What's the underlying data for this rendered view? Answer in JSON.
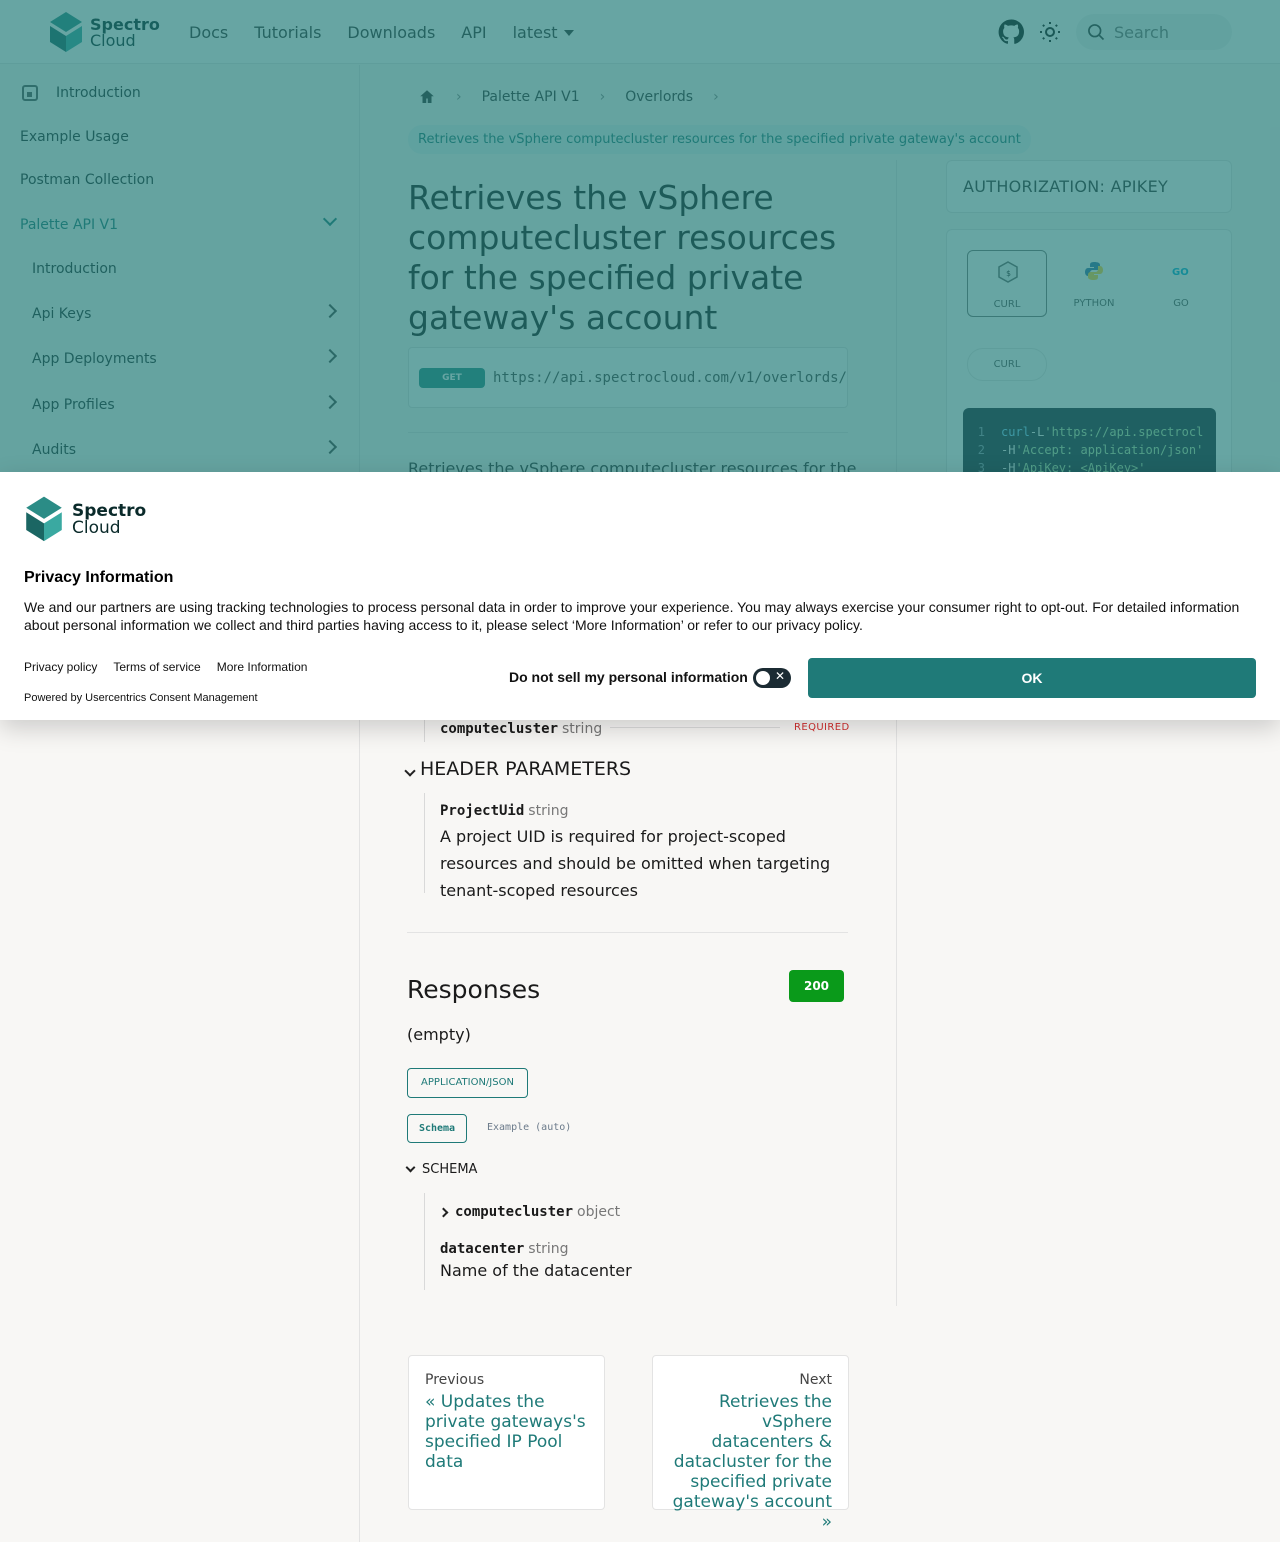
{
  "brand": {
    "line1": "Spectro",
    "line2": "Cloud"
  },
  "nav": {
    "links": [
      "Docs",
      "Tutorials",
      "Downloads",
      "API"
    ],
    "version": "latest",
    "search_placeholder": "Search"
  },
  "sidebar": {
    "items": [
      {
        "label": "Introduction",
        "level": 0
      },
      {
        "label": "Example Usage",
        "level": 0
      },
      {
        "label": "Postman Collection",
        "level": 0
      },
      {
        "label": "Palette API V1",
        "level": 0,
        "expanded": true
      },
      {
        "label": "Introduction",
        "level": 1
      },
      {
        "label": "Api Keys",
        "level": 1
      },
      {
        "label": "App Deployments",
        "level": 1
      },
      {
        "label": "App Profiles",
        "level": 1
      },
      {
        "label": "Audits",
        "level": 1
      }
    ]
  },
  "breadcrumb": {
    "items": [
      "Palette API V1",
      "Overlords"
    ],
    "current": "Retrieves the vSphere computecluster resources for the specified private gateway's account"
  },
  "page": {
    "title": "Retrieves the vSphere computecluster resources for the specified private gateway's account",
    "method": "GET",
    "url": "https://api.spectrocloud.com/v1/overlords/",
    "desc_peek": "Retrieves the vSphere computecluster resources for the"
  },
  "auth": {
    "label": "AUTHORIZATION: APIKEY"
  },
  "code": {
    "tabs": [
      "CURL",
      "PYTHON",
      "GO"
    ],
    "active_tab": "CURL",
    "sub_tab": "CURL",
    "lines": [
      {
        "n": "1",
        "a": "curl",
        "b": " -L ",
        "c": "'https://api.spectrocl"
      },
      {
        "n": "2",
        "a": "",
        "b": "-H ",
        "c": "'Accept: application/json'"
      },
      {
        "n": "3",
        "a": "",
        "b": "-H ",
        "c": "'ApiKey: <ApiKey>'"
      }
    ]
  },
  "params": {
    "path_last": {
      "name": "computecluster",
      "type": "string",
      "required": "REQUIRED"
    },
    "header_title": "HEADER PARAMETERS",
    "header": {
      "name": "ProjectUid",
      "type": "string",
      "description": "A project UID is required for project-scoped resources and should be omitted when targeting tenant-scoped resources"
    }
  },
  "responses": {
    "title": "Responses",
    "code": "200",
    "description": "(empty)",
    "content_type": "APPLICATION/JSON",
    "tabs": [
      "Schema",
      "Example (auto)"
    ],
    "schema_label": "SCHEMA",
    "fields": [
      {
        "name": "computecluster",
        "type": "object"
      },
      {
        "name": "datacenter",
        "type": "string",
        "description": "Name of the datacenter"
      }
    ]
  },
  "pager": {
    "prev_label": "Previous",
    "prev_title": "« Updates the private gateways's specified IP Pool data",
    "next_label": "Next",
    "next_title": "Retrieves the vSphere datacenters & datacluster for the specified private gateway's account »"
  },
  "consent": {
    "title": "Privacy Information",
    "body": "We and our partners are using tracking technologies to process personal data in order to improve your experience. You may always exercise your consumer right to opt-out. For detailed information about personal information we collect and third parties having access to it, please select ‘More Information’ or refer to our privacy policy.",
    "links": [
      "Privacy policy",
      "Terms of service",
      "More Information"
    ],
    "powered": "Powered by Usercentrics Consent Management",
    "dns_label": "Do not sell my personal information",
    "ok": "OK"
  },
  "colors": {
    "accent": "#1f7a78",
    "success": "#0a9a1a",
    "required": "#d32f2f"
  }
}
